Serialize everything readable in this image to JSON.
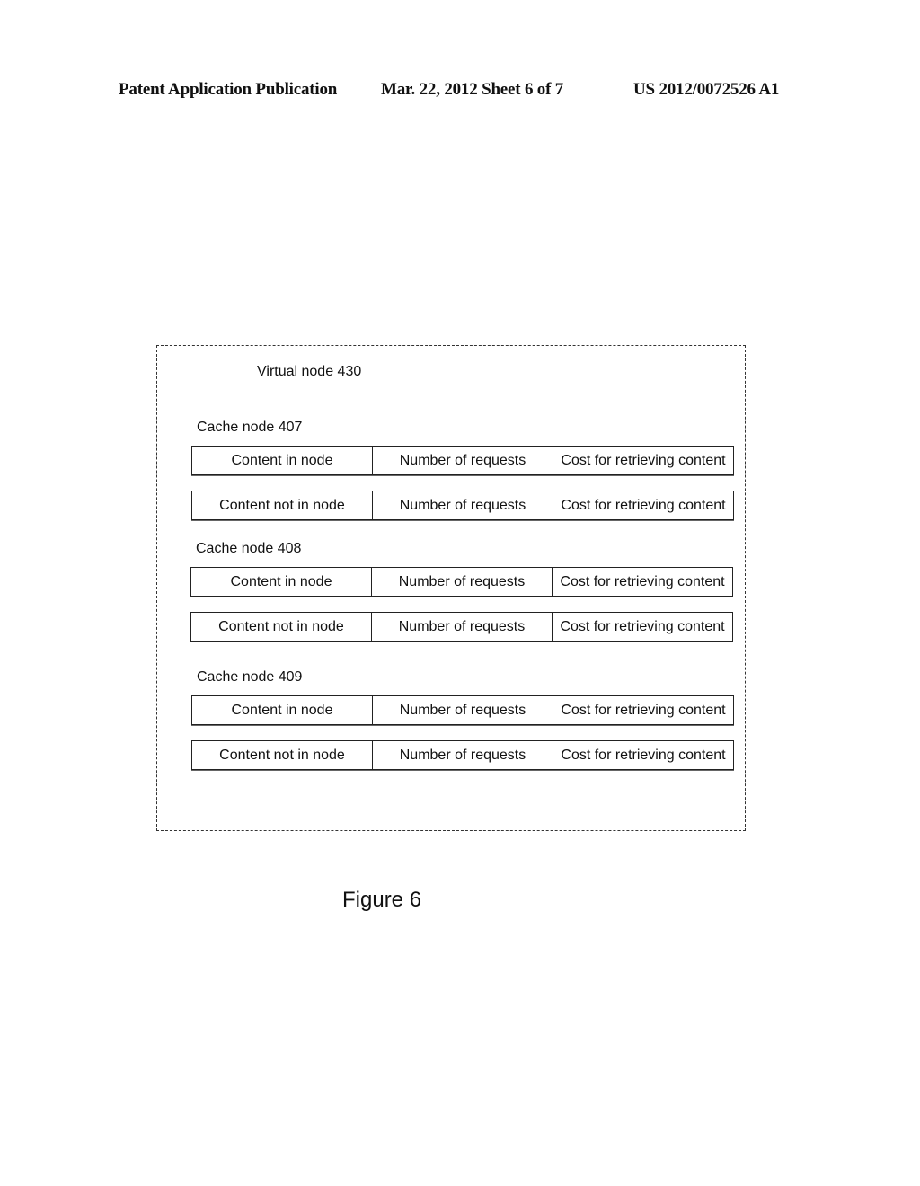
{
  "header": {
    "publication": "Patent Application Publication",
    "date_sheet": "Mar. 22, 2012  Sheet 6 of 7",
    "number": "US 2012/0072526 A1"
  },
  "diagram": {
    "virtual_node_label": "Virtual node 430",
    "cache_nodes": [
      {
        "label": "Cache node 407",
        "rows": [
          {
            "content": "Content in node",
            "requests": "Number of requests",
            "cost": "Cost for retrieving content"
          },
          {
            "content": "Content not in node",
            "requests": "Number of requests",
            "cost": "Cost for retrieving content"
          }
        ]
      },
      {
        "label": "Cache node 408",
        "rows": [
          {
            "content": "Content in node",
            "requests": "Number of requests",
            "cost": "Cost for retrieving content"
          },
          {
            "content": "Content not in node",
            "requests": "Number of requests",
            "cost": "Cost for retrieving content"
          }
        ]
      },
      {
        "label": "Cache node 409",
        "rows": [
          {
            "content": "Content in node",
            "requests": "Number of requests",
            "cost": "Cost for retrieving content"
          },
          {
            "content": "Content not in node",
            "requests": "Number of requests",
            "cost": "Cost for retrieving content"
          }
        ]
      }
    ]
  },
  "figure_label": "Figure 6"
}
